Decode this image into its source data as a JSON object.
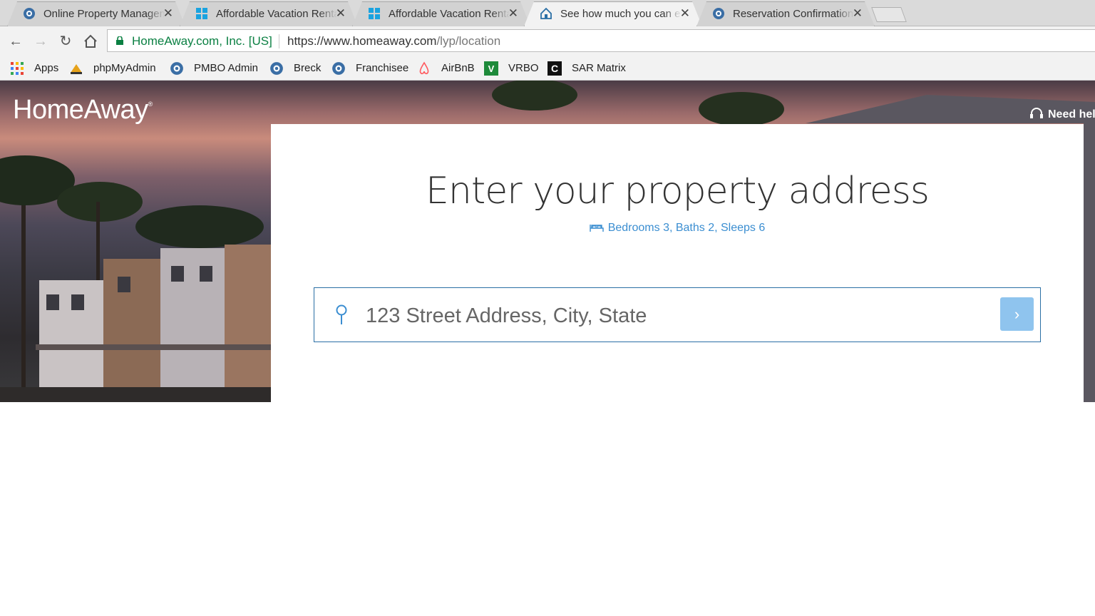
{
  "tabs": [
    {
      "title": "Online Property Management",
      "active": false,
      "favicon": "globe-icon"
    },
    {
      "title": "Affordable Vacation Rentals",
      "active": false,
      "favicon": "windows-icon"
    },
    {
      "title": "Affordable Vacation Rentals",
      "active": false,
      "favicon": "windows-icon"
    },
    {
      "title": "See how much you can earn",
      "active": true,
      "favicon": "homeaway-icon"
    },
    {
      "title": "Reservation Confirmation",
      "active": false,
      "favicon": "globe-icon"
    }
  ],
  "toolbar": {
    "origin": "HomeAway.com, Inc. [US]",
    "url_host": "https://www.homeaway.com",
    "url_path": "/lyp/location"
  },
  "bookmarks": [
    {
      "label": "Apps",
      "icon": "apps-grid-icon"
    },
    {
      "label": "phpMyAdmin",
      "icon": "phpmyadmin-icon"
    },
    {
      "label": "PMBO Admin",
      "icon": "globe-icon"
    },
    {
      "label": "Breck",
      "icon": "globe-icon"
    },
    {
      "label": "Franchisee",
      "icon": "globe-icon"
    },
    {
      "label": "AirBnB",
      "icon": "airbnb-icon"
    },
    {
      "label": "VRBO",
      "icon": "vrbo-icon"
    },
    {
      "label": "SAR Matrix",
      "icon": "sar-matrix-icon"
    }
  ],
  "page": {
    "logo": "HomeAway",
    "need_help": "Need hel",
    "heading": "Enter your property address",
    "property_summary": "Bedrooms 3, Baths 2, Sleeps 6",
    "search_placeholder": "123 Street Address, City, State",
    "go_glyph": "›"
  },
  "colors": {
    "accent": "#3b8ed1",
    "button": "#8fc4ee",
    "secure_green": "#0b8043"
  }
}
